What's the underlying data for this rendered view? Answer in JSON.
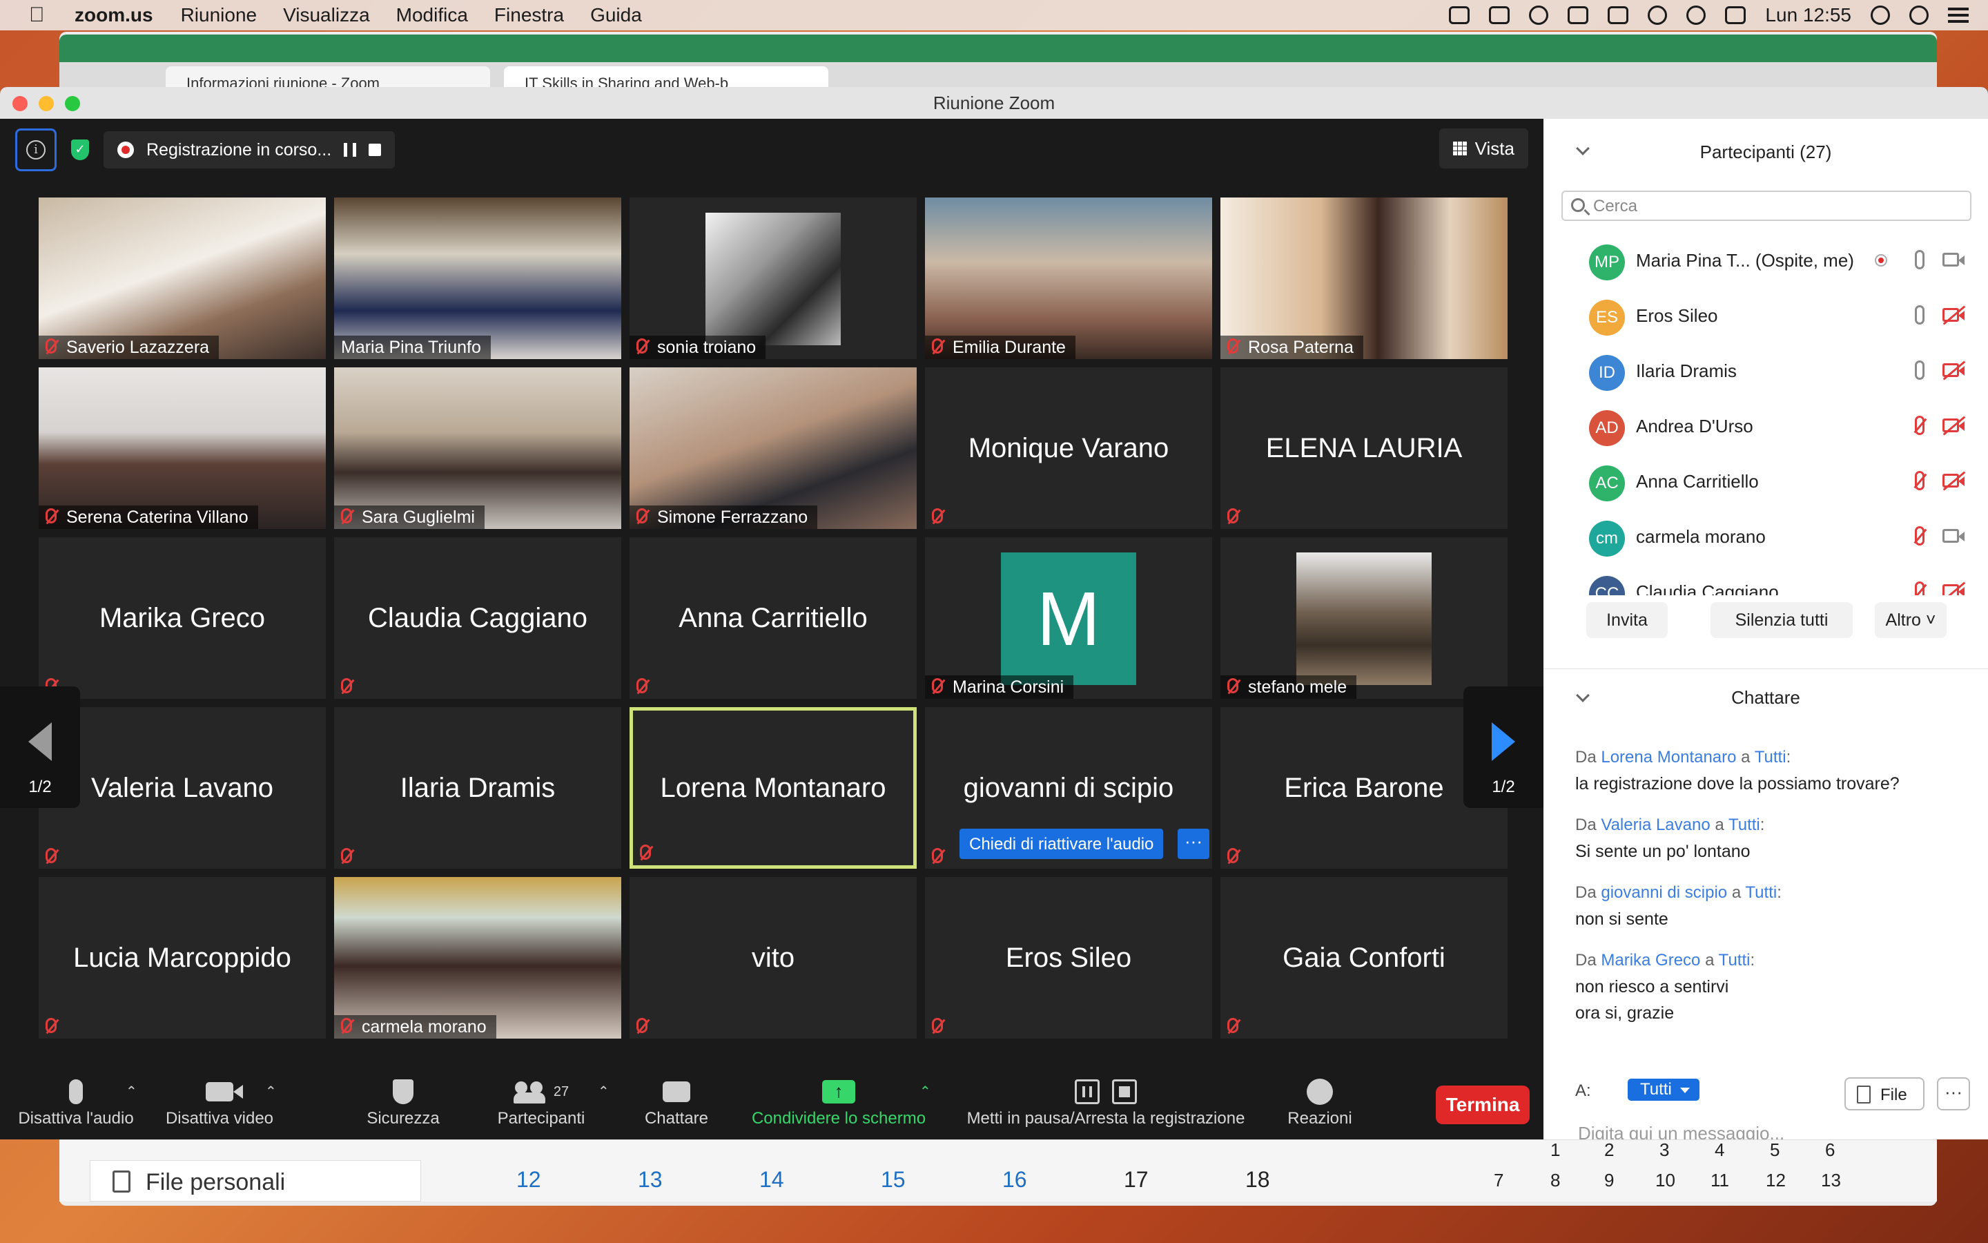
{
  "menubar": {
    "app_name": "zoom.us",
    "items": [
      "Riunione",
      "Visualizza",
      "Modifica",
      "Finestra",
      "Guida"
    ],
    "clock": "Lun 12:55"
  },
  "background": {
    "tab1": "Informazioni riunione - Zoom",
    "tab2": "IT Skills in Sharing and Web-b",
    "personal_files": "File personali",
    "calendar_days": [
      "12",
      "13",
      "14",
      "15",
      "16",
      "17",
      "18"
    ],
    "mini_top": [
      "1",
      "2",
      "3",
      "4",
      "5",
      "6"
    ],
    "mini_bottom": [
      "7",
      "8",
      "9",
      "10",
      "11",
      "12",
      "13"
    ]
  },
  "window": {
    "title": "Riunione Zoom"
  },
  "recording": {
    "status": "Registrazione in corso..."
  },
  "view_button": "Vista",
  "pager": {
    "left": "1/2",
    "right": "1/2"
  },
  "tiles": [
    {
      "name": "Saverio Lazazzera",
      "video": true
    },
    {
      "name": "Maria Pina Triunfo",
      "video": true
    },
    {
      "name": "sonia troiano",
      "video": true
    },
    {
      "name": "Emilia Durante",
      "video": true
    },
    {
      "name": "Rosa Paterna",
      "video": true
    },
    {
      "name": "Serena Caterina Villano",
      "video": true
    },
    {
      "name": "Sara Guglielmi",
      "video": true
    },
    {
      "name": "Simone Ferrazzano",
      "video": true
    },
    {
      "name": "Monique Varano",
      "video": false
    },
    {
      "name": "ELENA LAURIA",
      "video": false
    },
    {
      "name": "Marika Greco",
      "video": false
    },
    {
      "name": "Claudia Caggiano",
      "video": false
    },
    {
      "name": "Anna Carritiello",
      "video": false
    },
    {
      "name": "Marina Corsini",
      "video": false,
      "avatar_letter": "M"
    },
    {
      "name": "stefano mele",
      "video": false
    },
    {
      "name": "Valeria Lavano",
      "video": false
    },
    {
      "name": "Ilaria Dramis",
      "video": false
    },
    {
      "name": "Lorena Montanaro",
      "video": false
    },
    {
      "name": "giovanni di scipio",
      "video": false
    },
    {
      "name": "Erica Barone",
      "video": false
    },
    {
      "name": "Lucia Marcoppido",
      "video": false
    },
    {
      "name": "carmela morano",
      "video": true
    },
    {
      "name": "vito",
      "video": false
    },
    {
      "name": "Eros Sileo",
      "video": false
    },
    {
      "name": "Gaia Conforti",
      "video": false
    }
  ],
  "unmute_request": "Chiedi di riattivare l'audio",
  "more_label": "···",
  "toolbar": {
    "audio": "Disattiva l'audio",
    "video": "Disattiva video",
    "security": "Sicurezza",
    "participants": "Partecipanti",
    "participants_count": "27",
    "chat": "Chattare",
    "share": "Condividere lo schermo",
    "record": "Metti in pausa/Arresta la registrazione",
    "reactions": "Reazioni",
    "end": "Termina"
  },
  "participants_panel": {
    "title": "Partecipanti (27)",
    "search_placeholder": "Cerca",
    "list": [
      {
        "initials": "MP",
        "name": "Maria Pina T...  (Ospite, me)",
        "color": "#2fb36b",
        "mic_muted": false,
        "cam_off": false
      },
      {
        "initials": "ES",
        "name": "Eros Sileo",
        "color": "#f2a93b",
        "mic_muted": false,
        "cam_off": true
      },
      {
        "initials": "ID",
        "name": "Ilaria Dramis",
        "color": "#3d86d6",
        "mic_muted": false,
        "cam_off": true
      },
      {
        "initials": "AD",
        "name": "Andrea D'Urso",
        "color": "#d9533c",
        "mic_muted": true,
        "cam_off": true
      },
      {
        "initials": "AC",
        "name": "Anna Carritiello",
        "color": "#2fb36b",
        "mic_muted": true,
        "cam_off": true
      },
      {
        "initials": "cm",
        "name": "carmela morano",
        "color": "#1ea89b",
        "mic_muted": true,
        "cam_off": false
      },
      {
        "initials": "CC",
        "name": "Claudia Caggiano",
        "color": "#3b5d8f",
        "mic_muted": true,
        "cam_off": true
      }
    ],
    "invite": "Invita",
    "mute_all": "Silenzia tutti",
    "more": "Altro"
  },
  "chat_panel": {
    "title": "Chattare",
    "from_word": "Da",
    "to_word": "a",
    "messages": [
      {
        "from": "Lorena Montanaro",
        "to": "Tutti",
        "lines": [
          "la registrazione dove la possiamo trovare?"
        ]
      },
      {
        "from": "Valeria Lavano",
        "to": "Tutti",
        "lines": [
          "Si sente un po' lontano"
        ]
      },
      {
        "from": "giovanni di scipio",
        "to": "Tutti",
        "lines": [
          "non si sente"
        ]
      },
      {
        "from": "Marika Greco",
        "to": "Tutti",
        "lines": [
          "non riesco a sentirvi",
          "ora si, grazie"
        ]
      }
    ],
    "to_label": "A:",
    "to_value": "Tutti",
    "file_button": "File",
    "input_placeholder": "Digita qui un messaggio..."
  }
}
